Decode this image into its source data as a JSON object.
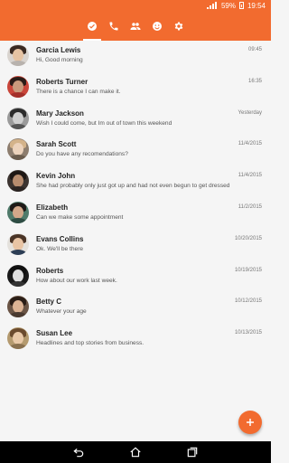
{
  "status_bar": {
    "battery": "59%",
    "time": "19:54"
  },
  "toolbar": {
    "tabs": [
      {
        "icon": "check-circle-icon",
        "active": true
      },
      {
        "icon": "phone-icon",
        "active": false
      },
      {
        "icon": "people-icon",
        "active": false
      },
      {
        "icon": "smiley-icon",
        "active": false
      },
      {
        "icon": "gear-icon",
        "active": false
      }
    ],
    "accent_color": "#f26b2f"
  },
  "conversations": [
    {
      "name": "Garcia Lewis",
      "message": "Hi, Good morning",
      "time": "09:45"
    },
    {
      "name": "Roberts Turner",
      "message": "There is a chance I can make it.",
      "time": "16:35"
    },
    {
      "name": "Mary Jackson",
      "message": "Wish I could come, but Im out of town this weekend",
      "time": "Yesterday"
    },
    {
      "name": "Sarah Scott",
      "message": "Do you have any recomendations?",
      "time": "11/4/2015"
    },
    {
      "name": "Kevin John",
      "message": "She had probably only just got up and had not even begun to get dressed",
      "time": "11/4/2015"
    },
    {
      "name": "Elizabeth",
      "message": "Can we make some appointment",
      "time": "11/2/2015"
    },
    {
      "name": "Evans Collins",
      "message": "Ok. We'll be there",
      "time": "10/20/2015"
    },
    {
      "name": "Roberts",
      "message": "How about our work last week.",
      "time": "10/19/2015"
    },
    {
      "name": "Betty C",
      "message": "Whatever your age",
      "time": "10/12/2015"
    },
    {
      "name": "Susan Lee",
      "message": "Headlines and top stories from business.",
      "time": "10/13/2015"
    }
  ],
  "fab": {
    "icon": "plus-icon"
  },
  "nav_bar": {
    "icons": [
      "back-icon",
      "home-icon",
      "recents-icon"
    ]
  }
}
